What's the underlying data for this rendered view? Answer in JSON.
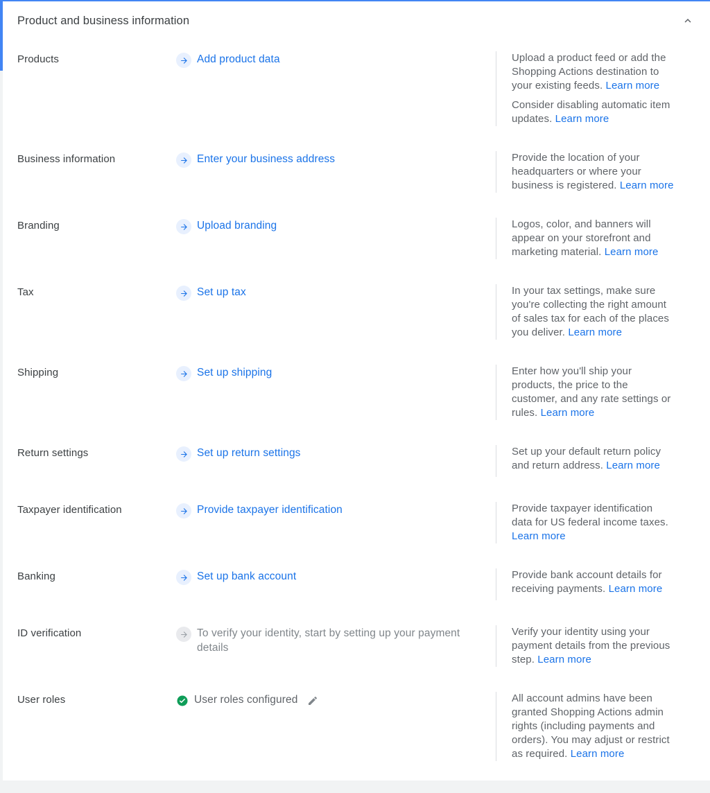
{
  "header": {
    "title": "Product and business information",
    "collapse_icon": "chevron-up-icon"
  },
  "rows": [
    {
      "label": "Products",
      "action": {
        "text": "Add product data",
        "icon": "arrow-right-icon",
        "state": "link"
      },
      "help": [
        {
          "text": "Upload a product feed or add the Shopping Actions destination to your existing feeds. ",
          "link": "Learn more"
        },
        {
          "text": "Consider disabling automatic item updates. ",
          "link": "Learn more"
        }
      ]
    },
    {
      "label": "Business information",
      "action": {
        "text": "Enter your business address",
        "icon": "arrow-right-icon",
        "state": "link"
      },
      "help": [
        {
          "text": "Provide the location of your headquarters or where your business is registered. ",
          "link": "Learn more"
        }
      ]
    },
    {
      "label": "Branding",
      "action": {
        "text": "Upload branding",
        "icon": "arrow-right-icon",
        "state": "link"
      },
      "help": [
        {
          "text": "Logos, color, and banners will appear on your storefront and marketing material. ",
          "link": "Learn more"
        }
      ]
    },
    {
      "label": "Tax",
      "action": {
        "text": "Set up tax",
        "icon": "arrow-right-icon",
        "state": "link"
      },
      "help": [
        {
          "text": "In your tax settings, make sure you're collecting the right amount of sales tax for each of the places you deliver. ",
          "link": "Learn more"
        }
      ]
    },
    {
      "label": "Shipping",
      "action": {
        "text": "Set up shipping",
        "icon": "arrow-right-icon",
        "state": "link"
      },
      "help": [
        {
          "text": "Enter how you'll ship your products, the price to the customer, and any rate settings or rules. ",
          "link": "Learn more"
        }
      ]
    },
    {
      "label": "Return settings",
      "action": {
        "text": "Set up return settings",
        "icon": "arrow-right-icon",
        "state": "link"
      },
      "help": [
        {
          "text": "Set up your default return policy and return address. ",
          "link": "Learn more"
        }
      ]
    },
    {
      "label": "Taxpayer identification",
      "action": {
        "text": "Provide taxpayer identification",
        "icon": "arrow-right-icon",
        "state": "link"
      },
      "help": [
        {
          "text": "Provide taxpayer identification data for US federal income taxes. ",
          "link": "Learn more"
        }
      ]
    },
    {
      "label": "Banking",
      "action": {
        "text": "Set up bank account",
        "icon": "arrow-right-icon",
        "state": "link"
      },
      "help": [
        {
          "text": "Provide bank account details for receiving payments. ",
          "link": "Learn more"
        }
      ]
    },
    {
      "label": "ID verification",
      "action": {
        "text": "To verify your identity, start by setting up your payment details",
        "icon": "arrow-right-icon",
        "state": "disabled"
      },
      "help": [
        {
          "text": "Verify your identity using your payment details from the previous step. ",
          "link": "Learn more"
        }
      ]
    },
    {
      "label": "User roles",
      "action": {
        "text": "User roles configured",
        "icon": "check-circle-icon",
        "edit_icon": "pencil-icon",
        "state": "done"
      },
      "help": [
        {
          "text": "All account admins have been granted Shopping Actions admin rights (including payments and orders). You may adjust or restrict as required. ",
          "link": "Learn more"
        }
      ]
    }
  ],
  "colors": {
    "accent": "#4285f4",
    "link": "#1a73e8",
    "link_chip_bg": "#e8f0fe",
    "text_primary": "#3c4043",
    "text_secondary": "#5f6368",
    "text_disabled": "#80868b",
    "success": "#0f9d58",
    "divider": "#dadce0",
    "page_bg": "#f1f3f4"
  }
}
